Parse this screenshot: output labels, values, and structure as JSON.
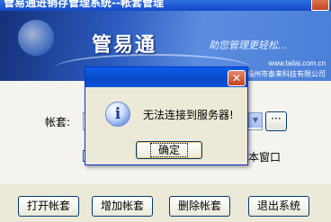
{
  "window": {
    "title": "管易通进销存管理系统--帐套管理"
  },
  "banner": {
    "product_name": "管易通",
    "slogan": "助您管理更轻松...",
    "url": "www.tailai.com.cn",
    "company": "福州市泰来科技有限公司"
  },
  "form": {
    "account_label": "帐套:",
    "browse_label": "···",
    "checkbox_label_visible": "本窗口"
  },
  "buttons": {
    "open": "打开帐套",
    "add": "增加帐套",
    "delete": "删除帐套",
    "exit": "退出系统"
  },
  "dialog": {
    "message": "无法连接到服务器!",
    "ok": "确定",
    "icon_glyph": "i",
    "close_glyph": "✕"
  }
}
